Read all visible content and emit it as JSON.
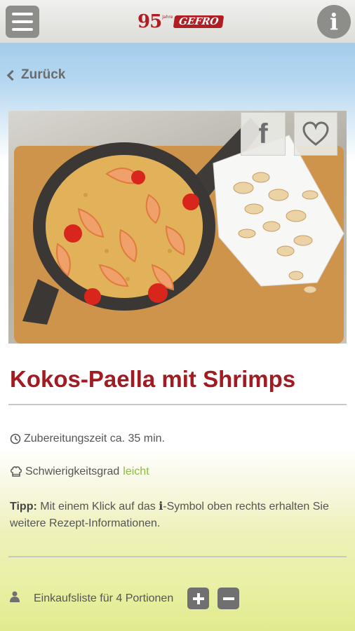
{
  "header": {
    "logo_years": "95",
    "logo_jahre": "Jahre",
    "logo_brand": "GEFRO",
    "info_glyph": "i",
    "menu_icon": "hamburger-menu-icon"
  },
  "nav": {
    "back_label": "Zurück"
  },
  "recipe": {
    "image_alt": "Kokos-Paella mit Shrimps in einer Pfanne mit Kokoschips",
    "facebook_glyph": "f",
    "title": "Kokos-Paella mit Shrimps",
    "prep_time": "Zubereitungszeit ca. 35 min.",
    "difficulty_label": "Schwierigkeitsgrad",
    "difficulty_value": "leicht",
    "tip_label": "Tipp:",
    "tip_text_before": " Mit einem Klick auf das ",
    "tip_icon_glyph": "i",
    "tip_text_after": "-Symbol oben rechts erhalten Sie weitere Rezept-Informationen.",
    "shopping_list": "Einkaufsliste für 4 Portionen"
  },
  "colors": {
    "accent_red": "#a01c22",
    "difficulty_green": "#8dbb3e",
    "button_gray": "#8d8d8a"
  }
}
